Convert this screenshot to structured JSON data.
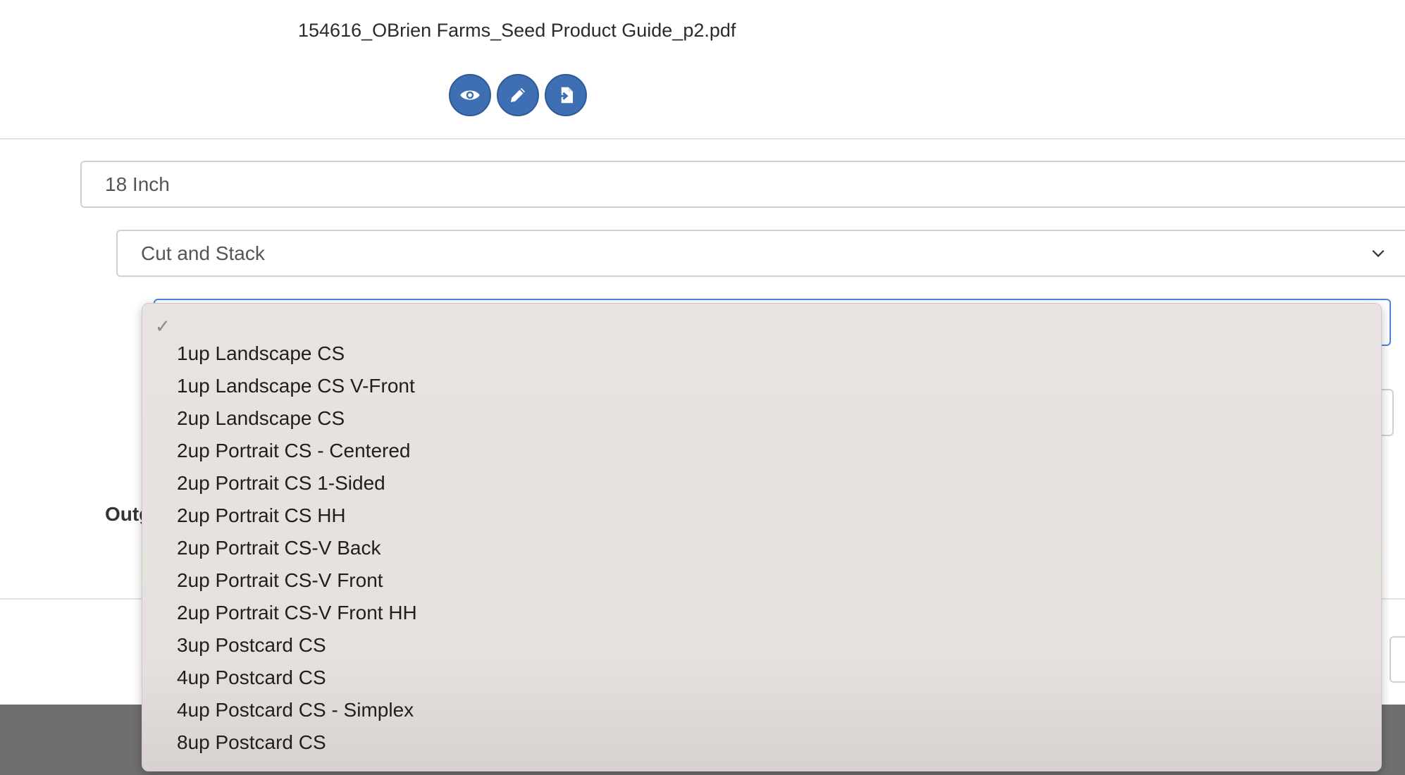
{
  "file": {
    "title": "154616_OBrien Farms_Seed Product Guide_p2.pdf",
    "actions": [
      {
        "name": "preview-button",
        "icon": "eye-icon"
      },
      {
        "name": "edit-button",
        "icon": "pencil-icon"
      },
      {
        "name": "import-button",
        "icon": "file-import-icon"
      }
    ]
  },
  "form": {
    "size_value": "18 Inch",
    "finishing_value": "Cut and Stack",
    "layout_value": "",
    "output_label": "Outg"
  },
  "dropdown": {
    "selected_mark": "✓",
    "options": [
      "1up Landscape CS",
      "1up Landscape CS V-Front",
      "2up Landscape CS",
      "2up Portrait CS - Centered",
      "2up Portrait CS 1-Sided",
      "2up Portrait CS HH",
      "2up Portrait CS-V Back",
      "2up Portrait CS-V Front",
      "2up Portrait CS-V Front HH",
      "3up Postcard CS",
      "4up Postcard CS",
      "4up Postcard CS - Simplex",
      "8up Postcard CS"
    ]
  },
  "colors": {
    "accent": "#3e6fb2",
    "focus_border": "#4a86d8",
    "menu_bg": "#e8e3e0"
  }
}
